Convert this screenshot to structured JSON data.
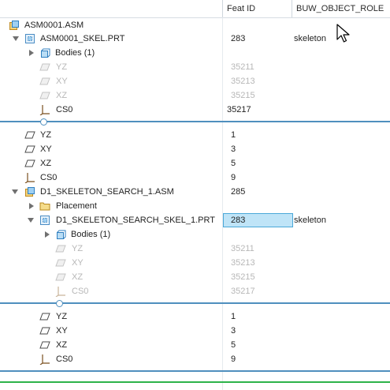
{
  "columns": {
    "feat_id": "Feat ID",
    "role": "BUW_OBJECT_ROLE"
  },
  "rows": [
    {
      "label": "ASM0001.ASM",
      "feat_id": "",
      "role": ""
    },
    {
      "label": "ASM0001_SKEL.PRT",
      "feat_id": "283",
      "role": "skeleton"
    },
    {
      "label": "Bodies (1)",
      "feat_id": "",
      "role": ""
    },
    {
      "label": "YZ",
      "feat_id": "35211",
      "role": ""
    },
    {
      "label": "XY",
      "feat_id": "35213",
      "role": ""
    },
    {
      "label": "XZ",
      "feat_id": "35215",
      "role": ""
    },
    {
      "label": "CS0",
      "feat_id": "35217",
      "role": ""
    },
    {
      "label": "YZ",
      "feat_id": "1",
      "role": ""
    },
    {
      "label": "XY",
      "feat_id": "3",
      "role": ""
    },
    {
      "label": "XZ",
      "feat_id": "5",
      "role": ""
    },
    {
      "label": "CS0",
      "feat_id": "9",
      "role": ""
    },
    {
      "label": "D1_SKELETON_SEARCH_1.ASM",
      "feat_id": "285",
      "role": ""
    },
    {
      "label": "Placement",
      "feat_id": "",
      "role": ""
    },
    {
      "label": "D1_SKELETON_SEARCH_SKEL_1.PRT",
      "feat_id": "283",
      "role": "skeleton"
    },
    {
      "label": "Bodies (1)",
      "feat_id": "",
      "role": ""
    },
    {
      "label": "YZ",
      "feat_id": "35211",
      "role": ""
    },
    {
      "label": "XY",
      "feat_id": "35213",
      "role": ""
    },
    {
      "label": "XZ",
      "feat_id": "35215",
      "role": ""
    },
    {
      "label": "CS0",
      "feat_id": "35217",
      "role": ""
    },
    {
      "label": "YZ",
      "feat_id": "1",
      "role": ""
    },
    {
      "label": "XY",
      "feat_id": "3",
      "role": ""
    },
    {
      "label": "XZ",
      "feat_id": "5",
      "role": ""
    },
    {
      "label": "CS0",
      "feat_id": "9",
      "role": ""
    }
  ],
  "colors": {
    "accent": "#4f8fbe",
    "selection": "#bfe4f7",
    "selection_border": "#4aa8d8",
    "insert_line": "#2db34a",
    "dim_text": "#b7b7b7"
  }
}
